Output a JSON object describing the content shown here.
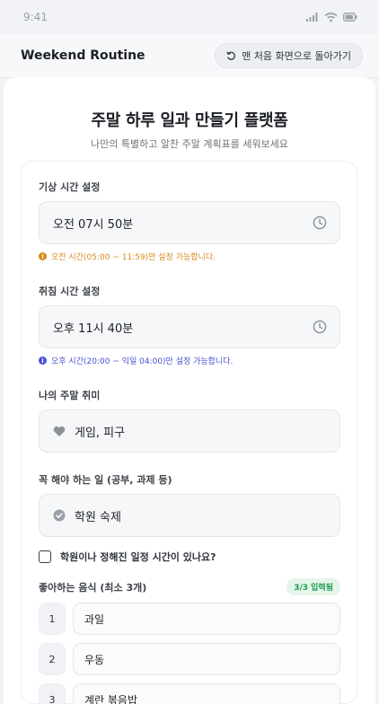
{
  "status": {
    "time": "9:41",
    "icons": [
      "signal-icon",
      "wifi-icon",
      "battery-icon"
    ]
  },
  "app_bar": {
    "title": "Weekend Routine",
    "home_button_label": "맨 처음 화면으로 돌아가기",
    "home_icon": "refresh-icon"
  },
  "hero": {
    "title": "주말 하루 일과 만들기 플랫폼",
    "subtitle": "나만의 특별하고 알찬 주말 계획표를 세워보세요"
  },
  "wake": {
    "label": "기상 시간 설정",
    "value": "오전 07시 50분",
    "hint": "오전 시간(05:00 ~ 11:59)만 설정 가능합니다.",
    "hint_color": "#d98a1c"
  },
  "sleep": {
    "label": "취침 시간 설정",
    "value": "오후 11시 40분",
    "hint": "오후 시간(20:00 ~ 익일 04:00)만 설정 가능합니다.",
    "hint_color": "#4b4fd6"
  },
  "hobby": {
    "label": "나의 주말 취미",
    "value": "게임, 피구",
    "icon": "heart-icon"
  },
  "todo": {
    "label": "꼭 해야 하는 일 (공부, 과제 등)",
    "value": "학원 숙제",
    "icon": "check-circle-icon"
  },
  "schedule_check": {
    "label": "학원이나 정해진 일정 시간이 있나요?",
    "checked": false
  },
  "foods": {
    "label": "좋아하는 음식 (최소 3개)",
    "badge": "3/3 입력됨",
    "items": [
      {
        "num": "1",
        "value": "과일"
      },
      {
        "num": "2",
        "value": "우동"
      },
      {
        "num": "3",
        "value": "계란 볶음밥"
      }
    ]
  }
}
